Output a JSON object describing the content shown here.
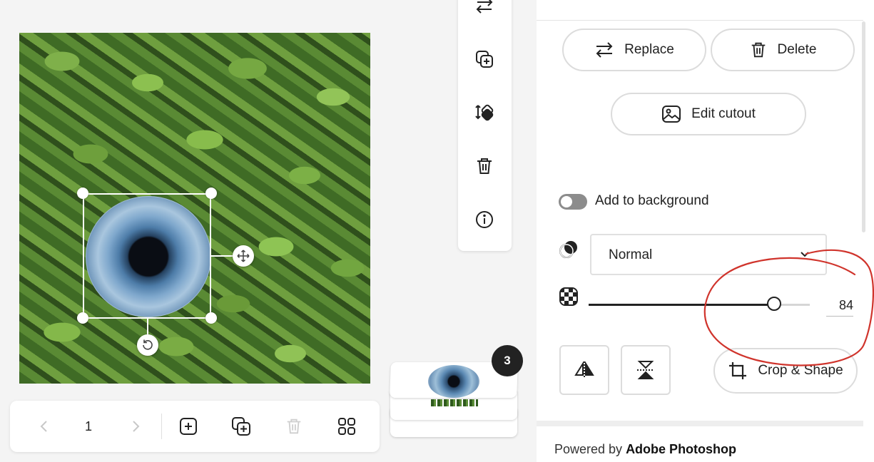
{
  "canvas": {
    "page_number": "1"
  },
  "stack": {
    "page_count": "3"
  },
  "panel": {
    "replace_label": "Replace",
    "delete_label": "Delete",
    "edit_cutout_label": "Edit cutout",
    "add_to_background_label": "Add to background",
    "add_to_background_on": false,
    "blend_mode": "Normal",
    "opacity_value": "84",
    "opacity_percent": 84,
    "crop_shape_label": "Crop & Shape"
  },
  "footer": {
    "prefix": "Powered by ",
    "brand": "Adobe Photoshop"
  },
  "annotation": {
    "color": "#d0342c"
  },
  "colors": {
    "accent": "#222222",
    "border": "#dcdcdc"
  }
}
